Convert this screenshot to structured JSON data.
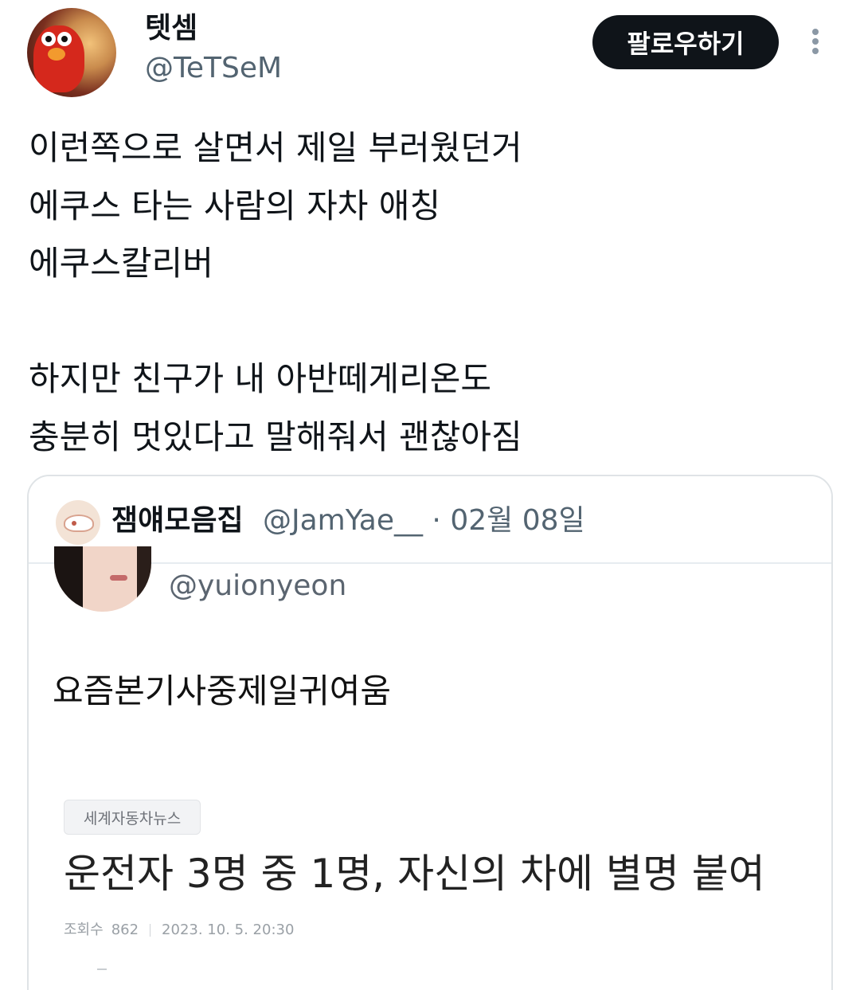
{
  "tweet": {
    "author": {
      "display_name": "텟셈",
      "handle": "@TeTSeM"
    },
    "follow_label": "팔로우하기",
    "text_lines": [
      "이런쪽으로 살면서 제일 부러웠던거",
      "에쿠스 타는 사람의 자차 애칭",
      "에쿠스칼리버",
      "",
      "하지만 친구가 내 아반떼게리온도",
      "충분히 멋있다고 말해줘서 괜찮아짐"
    ]
  },
  "quote": {
    "name": "잼얘모음집",
    "meta": "@JamYae__ · 02월 08일",
    "inner": {
      "handle": "@yuionyeon",
      "text": "요즘본기사중제일귀여움",
      "news": {
        "tag": "세계자동차뉴스",
        "headline": "운전자 3명 중 1명, 자신의 차에 별명 붙여",
        "views_label": "조회수",
        "views": "862",
        "date": "2023. 10. 5. 20:30"
      }
    }
  },
  "icons": {
    "more": "more-vertical-icon"
  },
  "colors": {
    "text_primary": "#0f1419",
    "text_secondary": "#536471",
    "follow_bg": "#0f1419",
    "border": "#dfe3e6"
  }
}
